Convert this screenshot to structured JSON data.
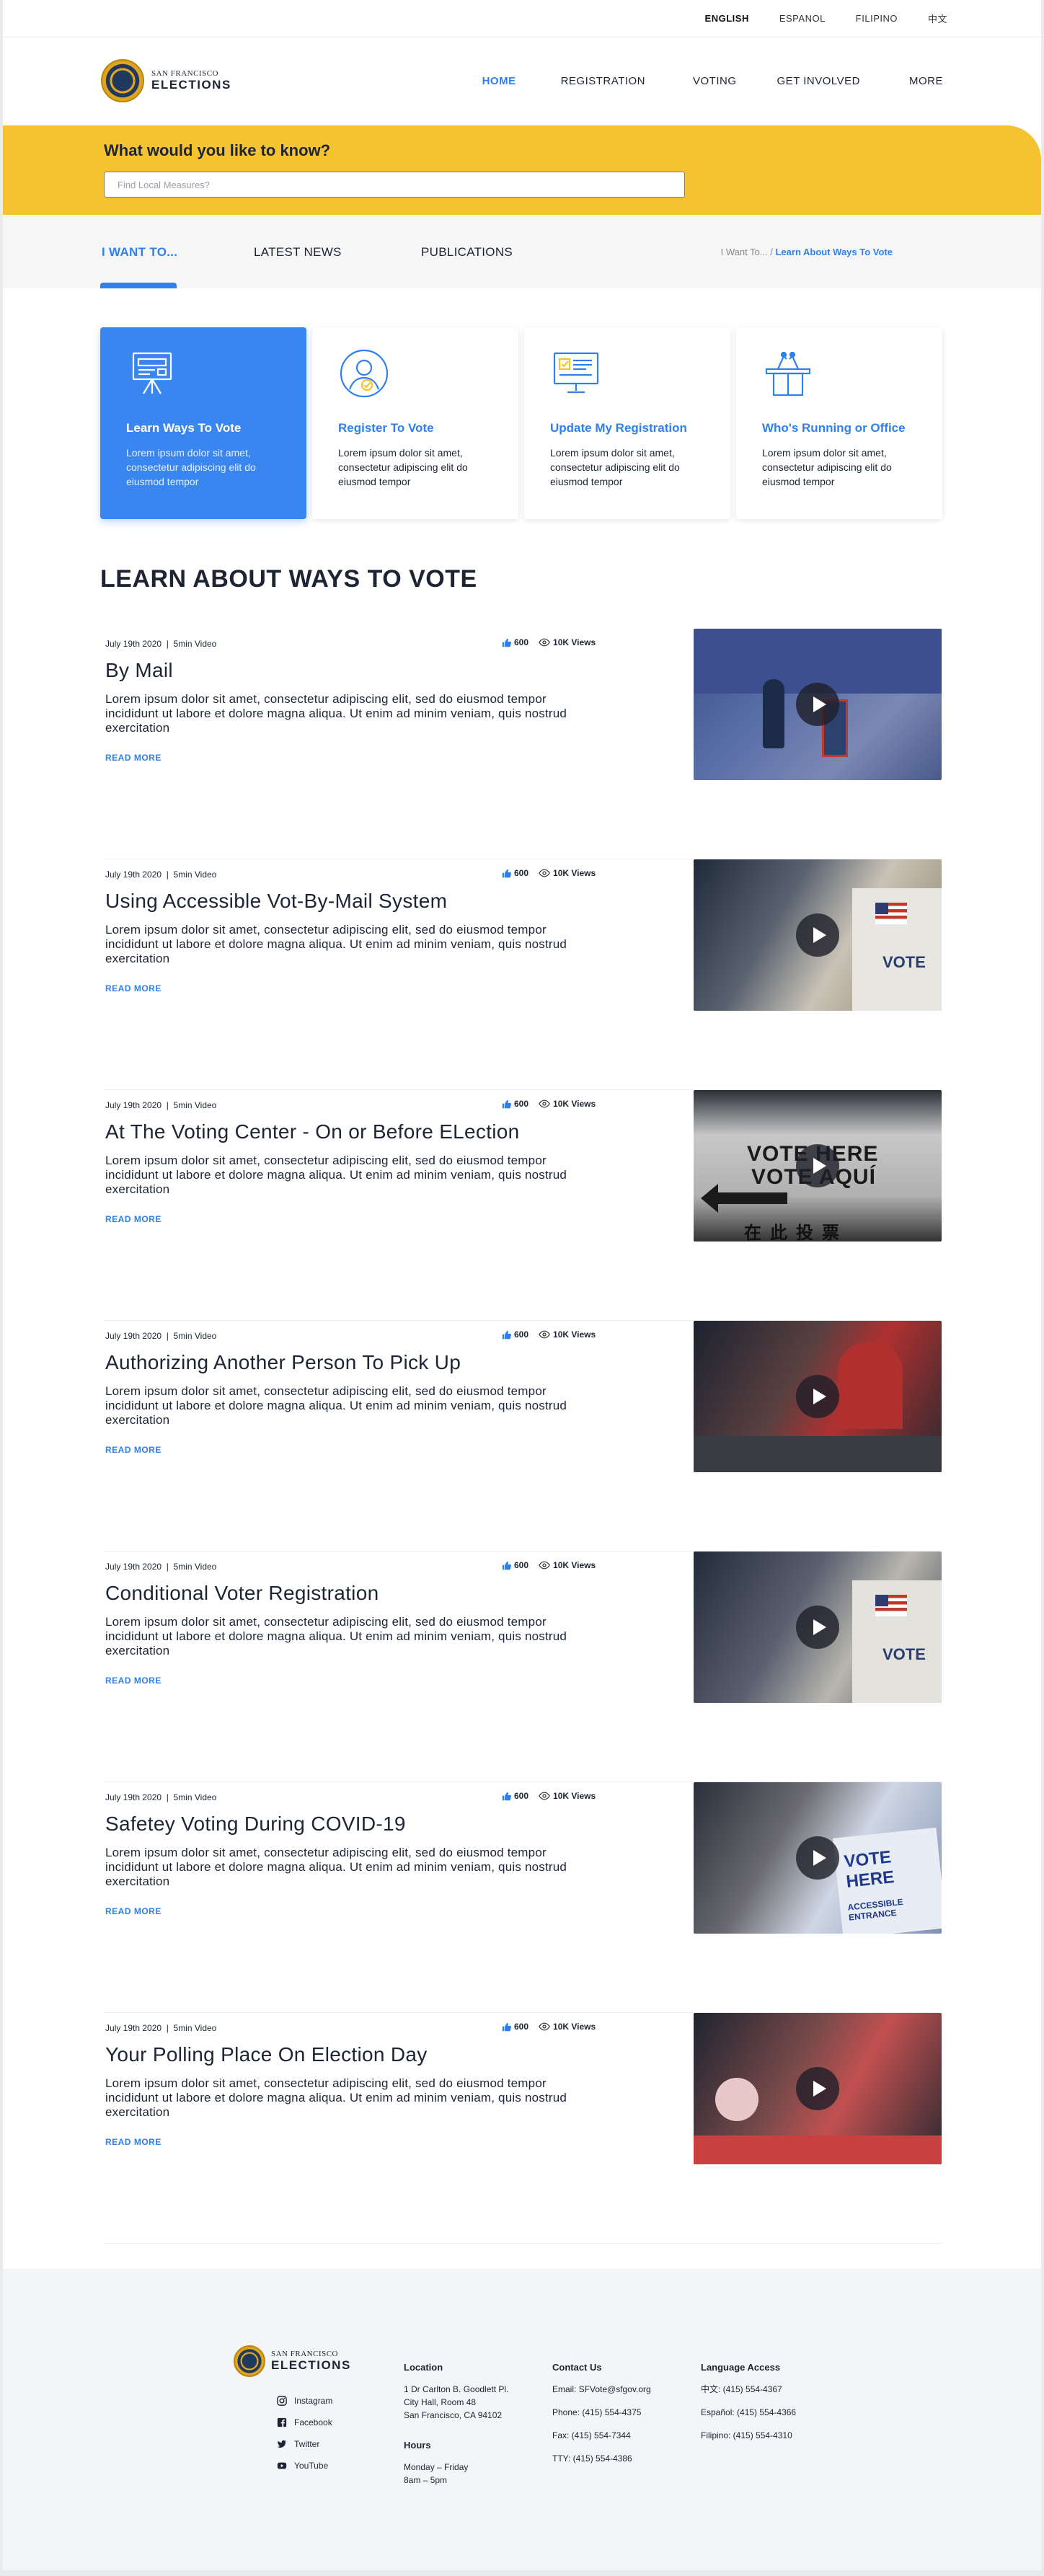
{
  "languages": [
    "ENGLISH",
    "ESPANOL",
    "FILIPINO",
    "中文"
  ],
  "brand": {
    "top": "SAN FRANCISCO",
    "bottom": "ELECTIONS"
  },
  "nav": [
    "HOME",
    "REGISTRATION",
    "VOTING",
    "GET INVOLVED",
    "MORE"
  ],
  "search": {
    "heading": "What would you like to know?",
    "placeholder": "Find Local Measures?"
  },
  "subnav": {
    "tabs": [
      "I WANT TO...",
      "LATEST NEWS",
      "PUBLICATIONS"
    ],
    "breadcrumb_root": "I Want To... /",
    "breadcrumb_current": "Learn About Ways To Vote"
  },
  "cards": [
    {
      "title": "Learn Ways To Vote",
      "text": "Lorem ipsum dolor sit amet, consectetur adipiscing elit do eiusmod tempor",
      "icon": "presentation-board-icon"
    },
    {
      "title": "Register To Vote",
      "text": "Lorem ipsum dolor sit amet, consectetur adipiscing elit do eiusmod tempor",
      "icon": "user-check-icon"
    },
    {
      "title": "Update My Registration",
      "text": "Lorem ipsum dolor sit amet, consectetur adipiscing elit do eiusmod tempor",
      "icon": "monitor-form-icon"
    },
    {
      "title": "Who's Running or Office",
      "text": "Lorem ipsum dolor sit amet, consectetur adipiscing elit do eiusmod tempor",
      "icon": "podium-icon"
    }
  ],
  "section_title": "LEARN ABOUT WAYS TO VOTE",
  "articles": [
    {
      "date": "July 19th 2020",
      "length": "5min Video",
      "likes": "600",
      "views": "10K Views",
      "title": "By Mail",
      "body": "Lorem ipsum dolor sit amet, consectetur adipiscing elit, sed do eiusmod tempor incididunt ut labore et dolore magna aliqua. Ut enim ad minim veniam, quis nostrud exercitation",
      "more": "READ MORE"
    },
    {
      "date": "July 19th 2020",
      "length": "5min Video",
      "likes": "600",
      "views": "10K Views",
      "title": "Using Accessible Vot-By-Mail System",
      "body": "Lorem ipsum dolor sit amet, consectetur adipiscing elit, sed do eiusmod tempor incididunt ut labore et dolore magna aliqua. Ut enim ad minim veniam, quis nostrud exercitation",
      "more": "READ MORE"
    },
    {
      "date": "July 19th 2020",
      "length": "5min Video",
      "likes": "600",
      "views": "10K Views",
      "title": "At The Voting Center - On or Before ELection",
      "body": "Lorem ipsum dolor sit amet, consectetur adipiscing elit, sed do eiusmod tempor incididunt ut labore et dolore magna aliqua. Ut enim ad minim veniam, quis nostrud exercitation",
      "more": "READ MORE"
    },
    {
      "date": "July 19th 2020",
      "length": "5min Video",
      "likes": "600",
      "views": "10K Views",
      "title": "Authorizing Another Person To Pick Up",
      "body": "Lorem ipsum dolor sit amet, consectetur adipiscing elit, sed do eiusmod tempor incididunt ut labore et dolore magna aliqua. Ut enim ad minim veniam, quis nostrud exercitation",
      "more": "READ MORE"
    },
    {
      "date": "July 19th 2020",
      "length": "5min Video",
      "likes": "600",
      "views": "10K Views",
      "title": "Conditional Voter Registration",
      "body": "Lorem ipsum dolor sit amet, consectetur adipiscing elit, sed do eiusmod tempor incididunt ut labore et dolore magna aliqua. Ut enim ad minim veniam, quis nostrud exercitation",
      "more": "READ MORE"
    },
    {
      "date": "July 19th 2020",
      "length": "5min Video",
      "likes": "600",
      "views": "10K Views",
      "title": "Safetey Voting During COVID-19",
      "body": "Lorem ipsum dolor sit amet, consectetur adipiscing elit, sed do eiusmod tempor incididunt ut labore et dolore magna aliqua. Ut enim ad minim veniam, quis nostrud exercitation",
      "more": "READ MORE"
    },
    {
      "date": "July 19th 2020",
      "length": "5min Video",
      "likes": "600",
      "views": "10K Views",
      "title": "Your Polling Place On Election Day",
      "body": "Lorem ipsum dolor sit amet, consectetur adipiscing elit, sed do eiusmod tempor incididunt ut labore et dolore magna aliqua. Ut enim ad minim veniam, quis nostrud exercitation",
      "more": "READ MORE"
    }
  ],
  "thumb_text": {
    "t1": "VOTE",
    "t2a": "VOTE HERE",
    "t2b": "VOTE AQUÍ",
    "t2c": "在此投票",
    "t4": "VOTE",
    "t5a": "VOTE HERE",
    "t5b": "ACCESSIBLE ENTRANCE"
  },
  "footer": {
    "social": [
      "Instagram",
      "Facebook",
      "Twitter",
      "YouTube"
    ],
    "location": {
      "heading": "Location",
      "lines": [
        "1 Dr Carlton B. Goodlett Pl.",
        "City Hall, Room 48",
        "San Francisco, CA 94102"
      ]
    },
    "hours": {
      "heading": "Hours",
      "lines": [
        "Monday – Friday",
        "8am – 5pm"
      ]
    },
    "contact": {
      "heading": "Contact Us",
      "lines": [
        "Email: SFVote@sfgov.org",
        "Phone: (415) 554-4375",
        "Fax: (415) 554-7344",
        "TTY: (415) 554-4386"
      ]
    },
    "language": {
      "heading": "Language Access",
      "lines": [
        "中文: (415) 554-4367",
        "Español: (415) 554-4366",
        "Filipino: (415) 554-4310"
      ]
    }
  },
  "colors": {
    "accent": "#2f80ed",
    "yellow": "#f5c330",
    "dark": "#1d2433"
  }
}
